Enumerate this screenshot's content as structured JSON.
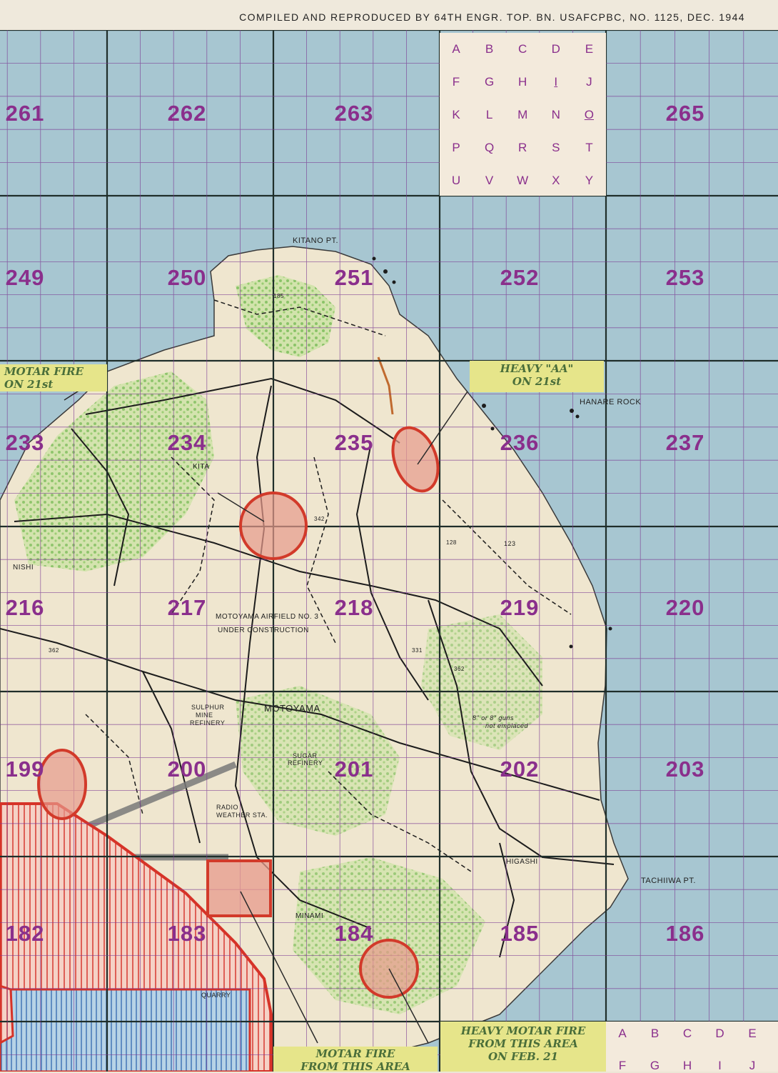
{
  "header": {
    "credit": "COMPILED AND REPRODUCED BY 64TH ENGR. TOP. BN. USAFCPBC, NO. 1125, DEC. 1944"
  },
  "grid_numbers": [
    "261",
    "262",
    "263",
    "265",
    "249",
    "250",
    "251",
    "252",
    "253",
    "233",
    "234",
    "235",
    "236",
    "237",
    "216",
    "217",
    "218",
    "219",
    "220",
    "199",
    "200",
    "201",
    "202",
    "203",
    "182",
    "183",
    "184",
    "185",
    "186"
  ],
  "key_top": [
    "A",
    "B",
    "C",
    "D",
    "E",
    "F",
    "G",
    "H",
    "I",
    "J",
    "K",
    "L",
    "M",
    "N",
    "O",
    "P",
    "Q",
    "R",
    "S",
    "T",
    "U",
    "V",
    "W",
    "X",
    "Y"
  ],
  "key_bottom": [
    "A",
    "B",
    "C",
    "D",
    "E",
    "F",
    "G",
    "H",
    "I",
    "J"
  ],
  "places": {
    "kitano_pt": "KITANO PT.",
    "hanare_rock": "HANARE ROCK",
    "kita": "KITA",
    "nishi": "NISHI",
    "airfield_1": "MOTOYAMA AIRFIELD NO. 3",
    "airfield_2": "UNDER CONSTRUCTION",
    "motoyama": "MOTOYAMA",
    "sulphur_1": "SULPHUR",
    "sulphur_2": "MINE",
    "sulphur_3": "REFINERY",
    "sugar_1": "SUGAR",
    "sugar_2": "REFINERY",
    "radio_1": "RADIO",
    "radio_2": "WEATHER STA.",
    "higashi": "HIGASHI",
    "tachiiwa": "TACHIIWA PT.",
    "minami": "MINAMI",
    "quarry": "QUARRY",
    "guns_1": "8\" or 8\" guns",
    "guns_2": "not emplaced"
  },
  "elevations": [
    "185",
    "342",
    "362",
    "331",
    "362",
    "128",
    "123"
  ],
  "notes": {
    "heavy_aa": [
      "HEAVY \"AA\"",
      "ON 21st"
    ],
    "motar_left": [
      "MOTAR FIRE",
      "ON 21st"
    ],
    "heavy_motar": [
      "HEAVY MOTAR FIRE",
      "FROM THIS AREA",
      "ON FEB. 21"
    ],
    "motar_bottom": [
      "MOTAR FIRE",
      "FROM THIS AREA"
    ]
  },
  "colors": {
    "sea": "#a7c6d1",
    "land": "#efe6cf",
    "vegetation": "#9ccf7a",
    "grid_major": "#1f2e2a",
    "grid_minor": "#7b3a93",
    "target_circle": "#d23a2a",
    "note_fill": "#e6e58a",
    "grid_label": "#8a2f8c"
  }
}
